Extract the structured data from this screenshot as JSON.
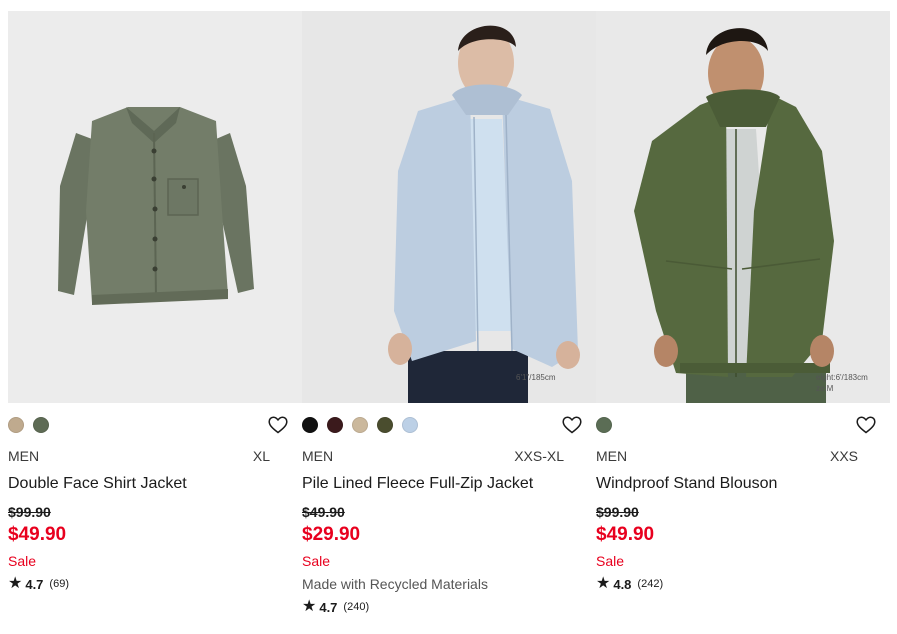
{
  "products": [
    {
      "swatches": [
        "#bfaa8e",
        "#5e6b55"
      ],
      "gender": "MEN",
      "sizes": "XL",
      "name": "Double Face Shirt Jacket",
      "original_price": "$99.90",
      "price": "$49.90",
      "sale_label": "Sale",
      "eco_label": "",
      "rating": "4.7",
      "rating_count": "(69)",
      "model_info_1": "",
      "model_info_2": ""
    },
    {
      "swatches": [
        "#111111",
        "#3b1a1c",
        "#cbb89c",
        "#4a4d2e",
        "#bcd0e6"
      ],
      "gender": "MEN",
      "sizes": "XXS-XL",
      "name": "Pile Lined Fleece Full-Zip Jacket",
      "original_price": "$49.90",
      "price": "$29.90",
      "sale_label": "Sale",
      "eco_label": "Made with Recycled Materials",
      "rating": "4.7",
      "rating_count": "(240)",
      "model_info_1": "6'1\"/185cm",
      "model_info_2": ""
    },
    {
      "swatches": [
        "#5b6d55"
      ],
      "gender": "MEN",
      "sizes": "XXS",
      "name": "Windproof Stand Blouson",
      "original_price": "$99.90",
      "price": "$49.90",
      "sale_label": "Sale",
      "eco_label": "",
      "rating": "4.8",
      "rating_count": "(242)",
      "model_info_1": "eight:6'/183cm",
      "model_info_2": "ze:M"
    }
  ],
  "icons": {
    "favorite": "heart-outline-icon",
    "star": "star-icon"
  },
  "colors": {
    "sale_red": "#e8001e",
    "text": "#1b1b1b"
  }
}
